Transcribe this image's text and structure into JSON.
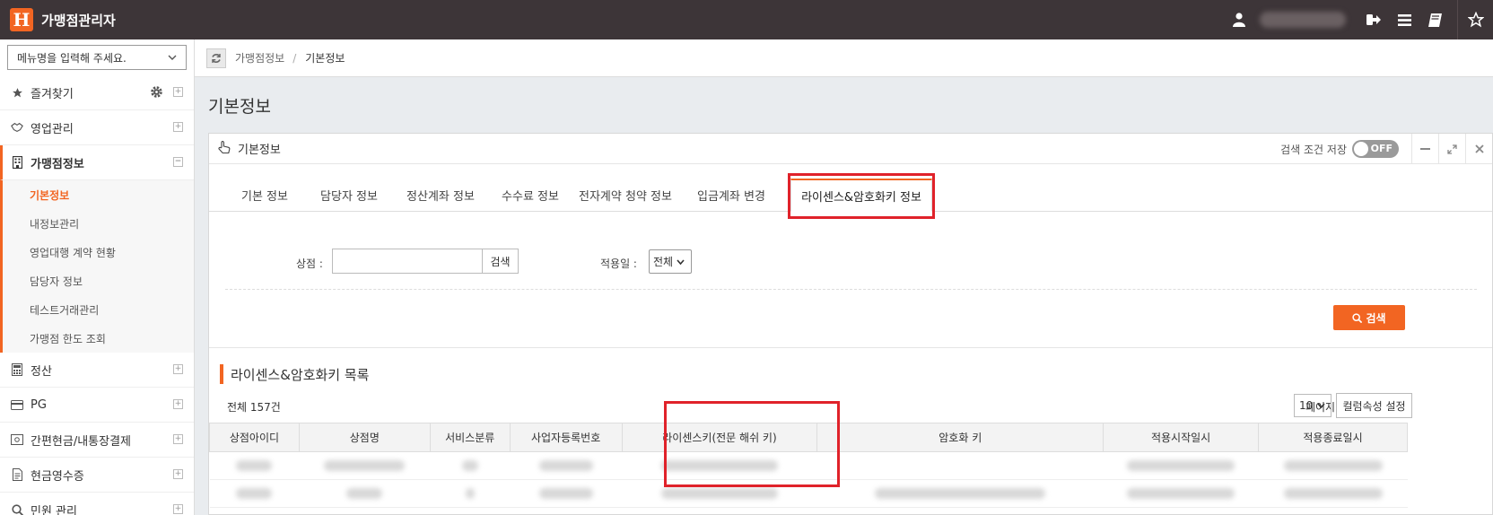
{
  "app": {
    "title": "가맹점관리자",
    "logo_letter": "H"
  },
  "topbar": {
    "icons": [
      "user-icon",
      "logout-icon",
      "menu-icon",
      "book-icon",
      "star-icon"
    ]
  },
  "sidebar": {
    "search_placeholder": "메뉴명을 입력해 주세요.",
    "items": [
      {
        "label": "즐겨찾기",
        "icon": "star-icon"
      },
      {
        "label": "영업관리",
        "icon": "handshake-icon"
      },
      {
        "label": "가맹점정보",
        "icon": "building-icon"
      }
    ],
    "sub_items": [
      "기본정보",
      "내정보관리",
      "영업대행 계약 현황",
      "담당자 정보",
      "테스트거래관리",
      "가맹점 한도 조회"
    ],
    "items_after": [
      {
        "label": "정산",
        "icon": "calculator-icon"
      },
      {
        "label": "PG",
        "icon": "card-icon"
      },
      {
        "label": "간편현금/내통장결제",
        "icon": "wallet-icon"
      },
      {
        "label": "현금영수증",
        "icon": "receipt-icon"
      },
      {
        "label": "민원 관리",
        "icon": "search-icon"
      }
    ]
  },
  "breadcrumb": {
    "parent": "가맹점정보",
    "sep": "/",
    "current": "기본정보"
  },
  "page_title": "기본정보",
  "card": {
    "title": "기본정보",
    "save_label": "검색 조건 저장",
    "toggle_label": "OFF"
  },
  "tabs": [
    "기본 정보",
    "담당자 정보",
    "정산계좌 정보",
    "수수료 정보",
    "전자계약 청약 정보",
    "입금계좌 변경",
    "라이센스&암호화키 정보"
  ],
  "filter": {
    "store_label": "상점 :",
    "store_value": "",
    "store_search_btn": "검색",
    "date_label": "적용일 :",
    "date_value": "전체",
    "search_btn": "검색"
  },
  "list": {
    "title": "라이센스&암호화키 목록",
    "total": "전체 157건",
    "per_page_label": "페이지당 줄수",
    "per_page_value": "10",
    "column_settings_btn": "컬럼속성 설정",
    "headers": [
      "상점아이디",
      "상점명",
      "서비스분류",
      "사업자등록번호",
      "라이센스키(전문 해쉬 키)",
      "암호화 키",
      "적용시작일시",
      "적용종료일시"
    ]
  }
}
